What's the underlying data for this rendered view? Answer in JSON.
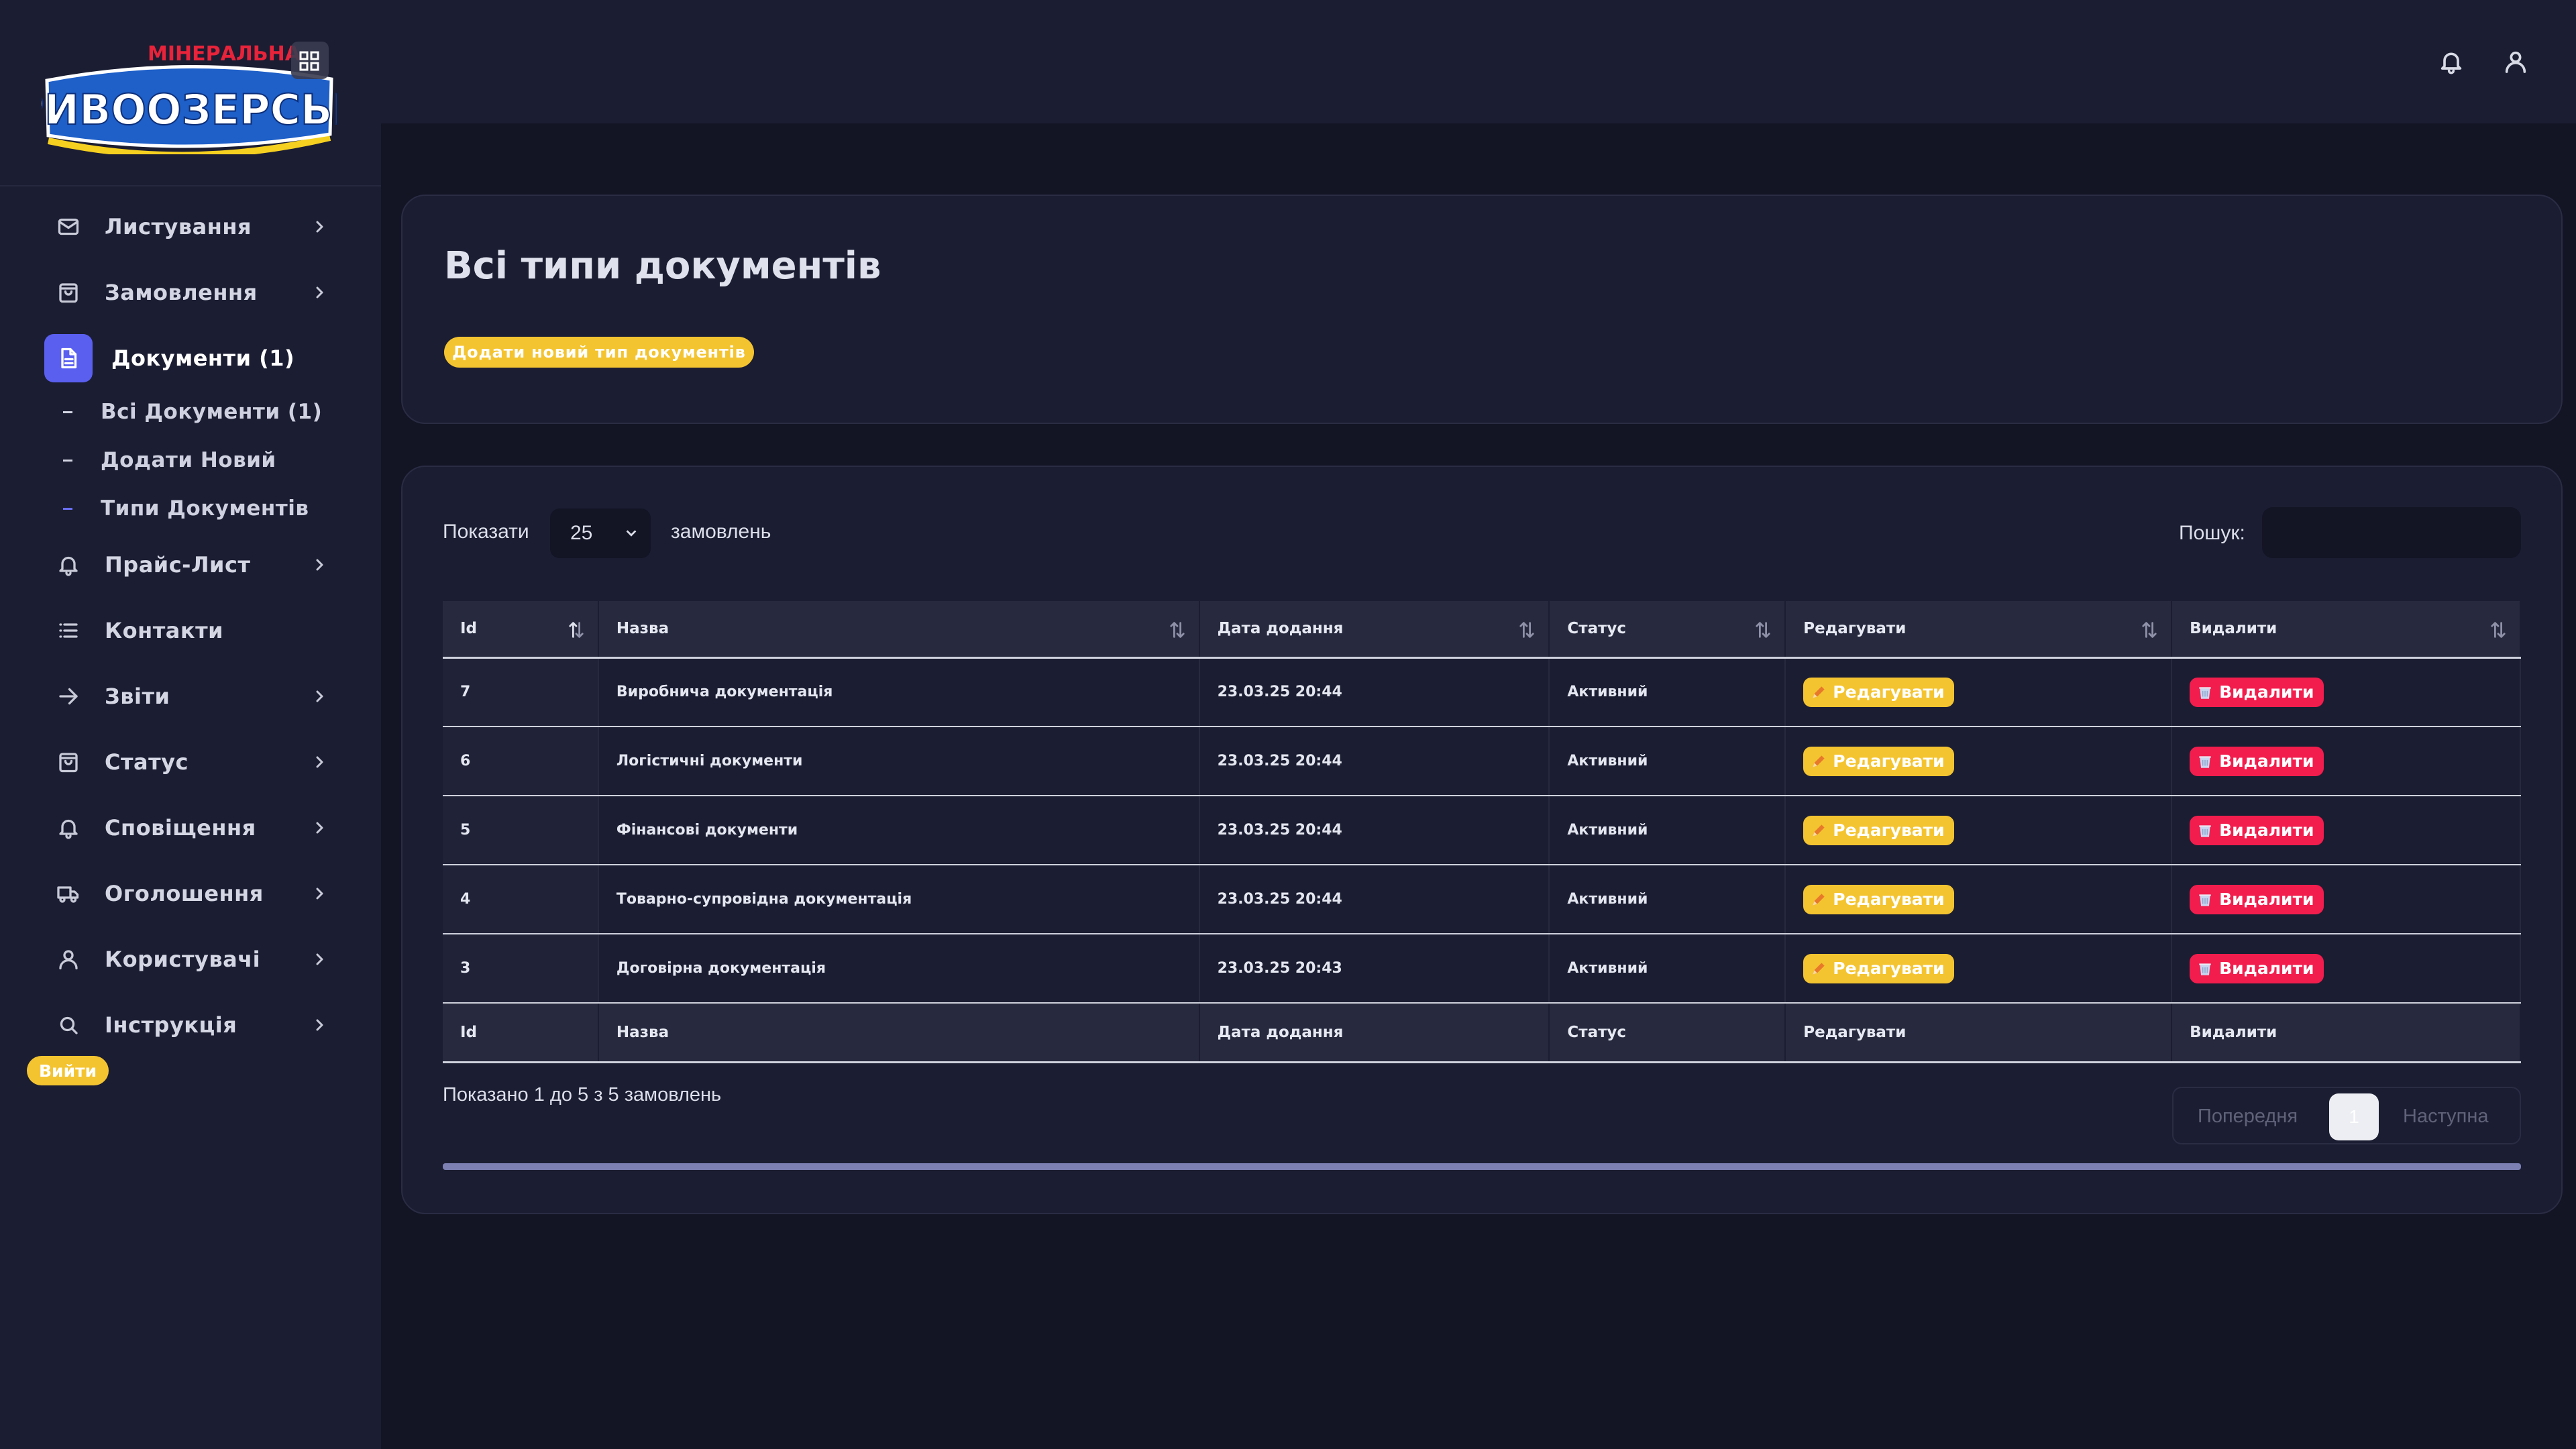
{
  "brand": {
    "logo_top": "МІНЕРАЛЬНА",
    "logo_main": "КРИВООЗЕРСЬКА"
  },
  "sidebar": {
    "items": [
      {
        "label": "Листування",
        "icon": "mail-icon"
      },
      {
        "label": "Замовлення",
        "icon": "shopping-bag-icon"
      },
      {
        "label": "Документи (1)",
        "icon": "document-icon"
      },
      {
        "label": "Прайс-Лист",
        "icon": "bell-icon"
      },
      {
        "label": "Контакти",
        "icon": "list-icon"
      },
      {
        "label": "Звіти",
        "icon": "arrow-right-icon"
      },
      {
        "label": "Статус",
        "icon": "shopping-bag-icon"
      },
      {
        "label": "Сповіщення",
        "icon": "bell-icon"
      },
      {
        "label": "Оголошення",
        "icon": "truck-icon"
      },
      {
        "label": "Користувачі",
        "icon": "user-icon"
      },
      {
        "label": "Інструкція",
        "icon": "search-icon"
      }
    ],
    "sub_items": [
      {
        "label": "Всі Документи (1)"
      },
      {
        "label": "Додати Новий"
      },
      {
        "label": "Типи Документів"
      }
    ],
    "logout_label": "Вийти"
  },
  "header": {
    "notifications_icon": "bell-icon",
    "profile_icon": "user-icon"
  },
  "page": {
    "title": "Всі типи документів",
    "add_button": "Додати новий тип документів"
  },
  "table_controls": {
    "show_label": "Показати",
    "page_size": "25",
    "show_after": "замовлень",
    "search_label": "Пошук:",
    "search_value": ""
  },
  "table": {
    "columns": [
      "Id",
      "Назва",
      "Дата додання",
      "Статус",
      "Редагувати",
      "Видалити"
    ],
    "rows": [
      {
        "id": "7",
        "name": "Виробнича документація",
        "date": "23.03.25 20:44",
        "status": "Активний",
        "edit": "Редагувати",
        "delete": "Видалити"
      },
      {
        "id": "6",
        "name": "Логістичні документи",
        "date": "23.03.25 20:44",
        "status": "Активний",
        "edit": "Редагувати",
        "delete": "Видалити"
      },
      {
        "id": "5",
        "name": "Фінансові документи",
        "date": "23.03.25 20:44",
        "status": "Активний",
        "edit": "Редагувати",
        "delete": "Видалити"
      },
      {
        "id": "4",
        "name": "Товарно-супровідна документація",
        "date": "23.03.25 20:44",
        "status": "Активний",
        "edit": "Редагувати",
        "delete": "Видалити"
      },
      {
        "id": "3",
        "name": "Договірна документація",
        "date": "23.03.25 20:43",
        "status": "Активний",
        "edit": "Редагувати",
        "delete": "Видалити"
      }
    ]
  },
  "pagination": {
    "info": "Показано 1 до 5 з 5 замовлень",
    "prev": "Попередня",
    "current": "1",
    "next": "Наступна"
  },
  "colors": {
    "background": "#131424",
    "panel": "#1b1d32",
    "accent": "#5a5ff0",
    "warning": "#f4c430",
    "danger": "#f21d4d"
  }
}
